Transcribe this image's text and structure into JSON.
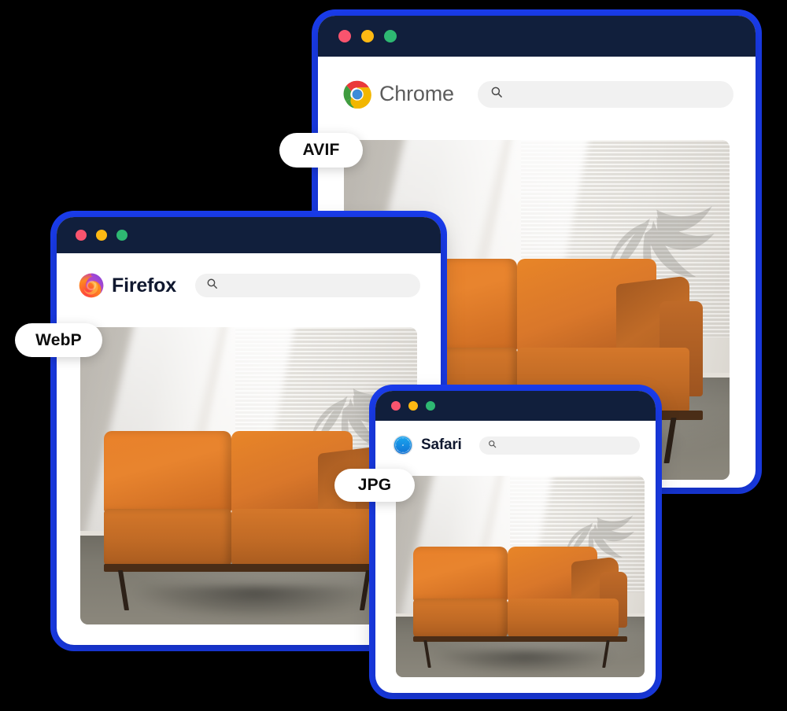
{
  "scene": {
    "description": "Three stacked browser mockup windows each showing the same leather sofa photo in a different image format",
    "accent_color": "#1a3df0",
    "titlebar_color": "#111f3c",
    "searchbar_color": "#f1f1f1",
    "badge_text_color": "#0d0d0d",
    "traffic_light_colors": [
      "#f9546e",
      "#fdb913",
      "#2eb872"
    ]
  },
  "windows": [
    {
      "id": "chrome",
      "browser_name": "Chrome",
      "logo_icon": "chrome-logo-icon",
      "search_placeholder": "",
      "search_value": "",
      "search_icon": "search-icon",
      "traffic_lights": [
        "close-dot",
        "minimize-dot",
        "maximize-dot"
      ],
      "photo_alt": "Tan leather sofa in sunlit room with palm shadow on wall"
    },
    {
      "id": "firefox",
      "browser_name": "Firefox",
      "logo_icon": "firefox-logo-icon",
      "search_placeholder": "",
      "search_value": "",
      "search_icon": "search-icon",
      "traffic_lights": [
        "close-dot",
        "minimize-dot",
        "maximize-dot"
      ],
      "photo_alt": "Tan leather sofa in sunlit room with palm shadow on wall"
    },
    {
      "id": "safari",
      "browser_name": "Safari",
      "logo_icon": "safari-compass-icon",
      "search_placeholder": "",
      "search_value": "",
      "search_icon": "search-icon",
      "traffic_lights": [
        "close-dot",
        "minimize-dot",
        "maximize-dot"
      ],
      "photo_alt": "Tan leather sofa in sunlit room with palm shadow on wall"
    }
  ],
  "badges": [
    {
      "id": "avif",
      "label": "AVIF",
      "for_window": "chrome"
    },
    {
      "id": "webp",
      "label": "WebP",
      "for_window": "firefox"
    },
    {
      "id": "jpg",
      "label": "JPG",
      "for_window": "safari"
    }
  ]
}
